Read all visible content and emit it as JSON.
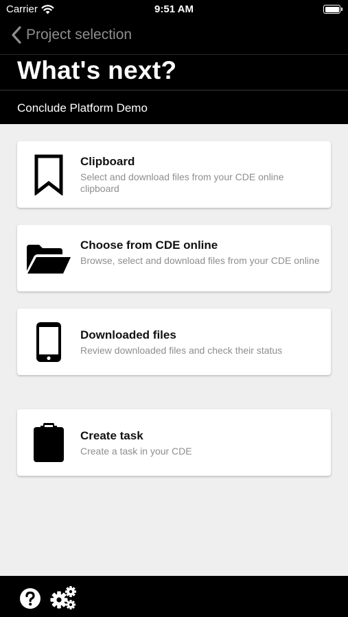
{
  "status_bar": {
    "carrier": "Carrier",
    "time": "9:51 AM"
  },
  "nav": {
    "back_label": "Project selection"
  },
  "header": {
    "title": "What's next?",
    "project_name": "Conclude Platform Demo"
  },
  "actions": [
    {
      "title": "Clipboard",
      "subtitle": "Select and download files from your CDE online clipboard",
      "icon": "bookmark-icon"
    },
    {
      "title": "Choose from CDE online",
      "subtitle": "Browse, select and download files from your CDE online",
      "icon": "folder-open-icon"
    },
    {
      "title": "Downloaded files",
      "subtitle": "Review downloaded files and check their status",
      "icon": "phone-icon"
    },
    {
      "title": "Create task",
      "subtitle": "Create a task in your CDE",
      "icon": "clipboard-icon"
    }
  ],
  "toolbar": {
    "icons": [
      "help-icon",
      "settings-icon"
    ]
  },
  "colors": {
    "header_bg": "#000000",
    "page_bg": "#efefef",
    "card_bg": "#ffffff",
    "subtitle_text": "#8e8e8e",
    "back_text": "#8e8e8e"
  }
}
